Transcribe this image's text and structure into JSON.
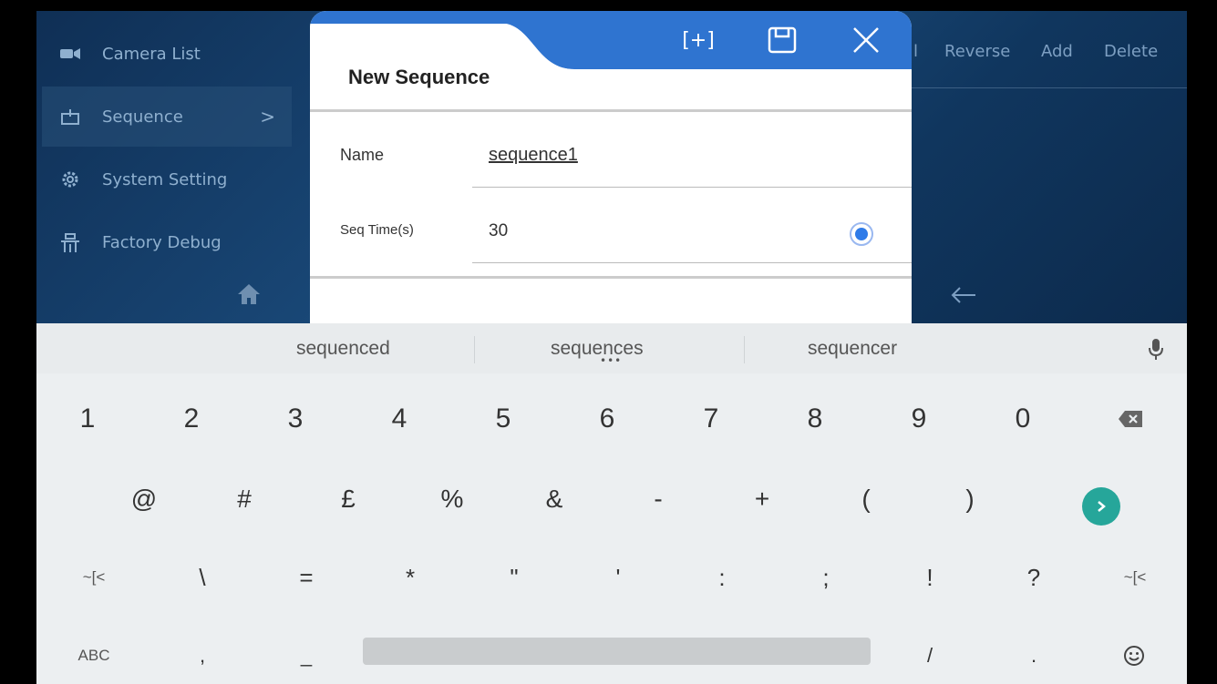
{
  "sidebar": {
    "items": [
      {
        "label": "Camera List",
        "icon": "camera-icon"
      },
      {
        "label": "Sequence",
        "icon": "sequence-icon",
        "active": true
      },
      {
        "label": "System Setting",
        "icon": "gear-icon"
      },
      {
        "label": "Factory Debug",
        "icon": "debug-icon"
      }
    ],
    "chevron": ">"
  },
  "top_actions": [
    "l",
    "Reverse",
    "Add",
    "Delete"
  ],
  "dialog": {
    "title": "New Sequence",
    "buttons": {
      "add": "[+]",
      "save": "save-icon",
      "close": "close-icon"
    },
    "name_label": "Name",
    "name_value": "sequence1",
    "seq_time_label": "Seq Time(s)",
    "seq_time_value": "30"
  },
  "keyboard": {
    "suggestions": [
      "sequenced",
      "sequences",
      "sequencer"
    ],
    "suggestion_dots": "•••",
    "row1": [
      "1",
      "2",
      "3",
      "4",
      "5",
      "6",
      "7",
      "8",
      "9",
      "0"
    ],
    "row2": [
      "@",
      "#",
      "£",
      "%",
      "&",
      "-",
      "+",
      "(",
      ")"
    ],
    "row3": [
      "~[<",
      "\\",
      "=",
      "*",
      "\"",
      "'",
      ":",
      ";",
      "!",
      "?",
      "~[<"
    ],
    "row4": {
      "abc": "ABC",
      "comma": ",",
      "underscore": "_",
      "slash": "/",
      "period": "."
    }
  },
  "colors": {
    "dialog_accent": "#2f74d0",
    "go_button": "#26a69a",
    "radio": "#2f7be8"
  }
}
